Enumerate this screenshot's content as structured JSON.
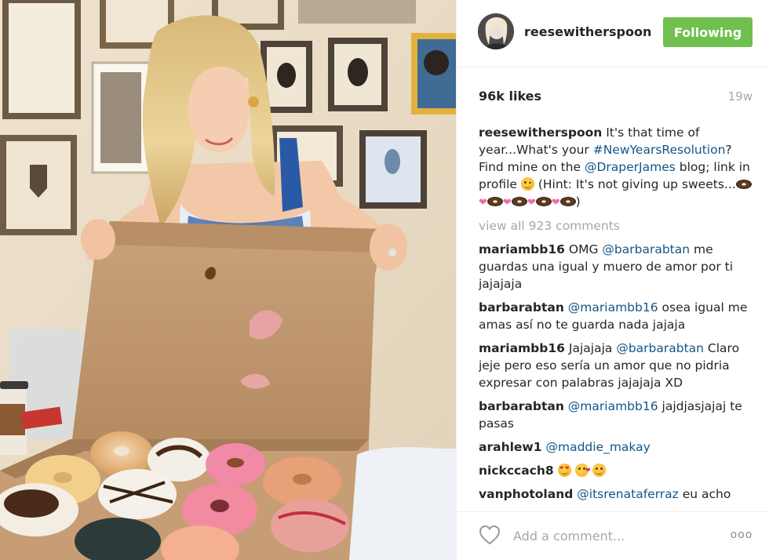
{
  "post": {
    "photo_alt": "",
    "header": {
      "username": "reesewitherspoon",
      "follow_label": "Following"
    },
    "likes_label": "96k likes",
    "time_ago": "19w",
    "caption": {
      "username": "reesewitherspoon",
      "text_1": "It's that time of year...What's your",
      "hashtag": "#NewYearsResolution",
      "text_2": "? Find mine on the",
      "mention": "@DraperJames",
      "text_3": "blog; link in profile",
      "text_4": "(Hint: It's not giving up sweets...",
      "text_5": ")"
    },
    "view_all_label": "view all 923 comments",
    "comments": [
      {
        "username": "mariambb16",
        "text_pre": "OMG",
        "mention": "@barbarabtan",
        "text_post": "me guardas una igual y muero de amor por ti jajajaja"
      },
      {
        "username": "barbarabtan",
        "text_pre": "",
        "mention": "@mariambb16",
        "text_post": "osea igual me amas así no te guarda nada jajaja"
      },
      {
        "username": "mariambb16",
        "text_pre": "Jajajaja",
        "mention": "@barbarabtan",
        "text_post": "Claro jeje pero eso sería un amor que no pidria expresar con palabras jajajaja XD"
      },
      {
        "username": "barbarabtan",
        "text_pre": "",
        "mention": "@mariambb16",
        "text_post": "jajdjasjajaj te pasas"
      },
      {
        "username": "arahlew1",
        "text_pre": "",
        "mention": "@maddie_makay",
        "text_post": ""
      },
      {
        "username": "nickccach8",
        "text_pre": "",
        "mention": "",
        "text_post": ""
      },
      {
        "username": "vanphotoland",
        "text_pre": "",
        "mention": "@itsrenataferraz",
        "text_post": "eu acho"
      }
    ],
    "footer": {
      "comment_placeholder": "Add a comment...",
      "more_label": "ooo"
    },
    "colors": {
      "follow_button": "#70c050",
      "link": "#125688",
      "muted": "#a5a7aa"
    },
    "icons": [
      "heart-outline-icon",
      "more-options-icon",
      "profile-avatar"
    ]
  }
}
